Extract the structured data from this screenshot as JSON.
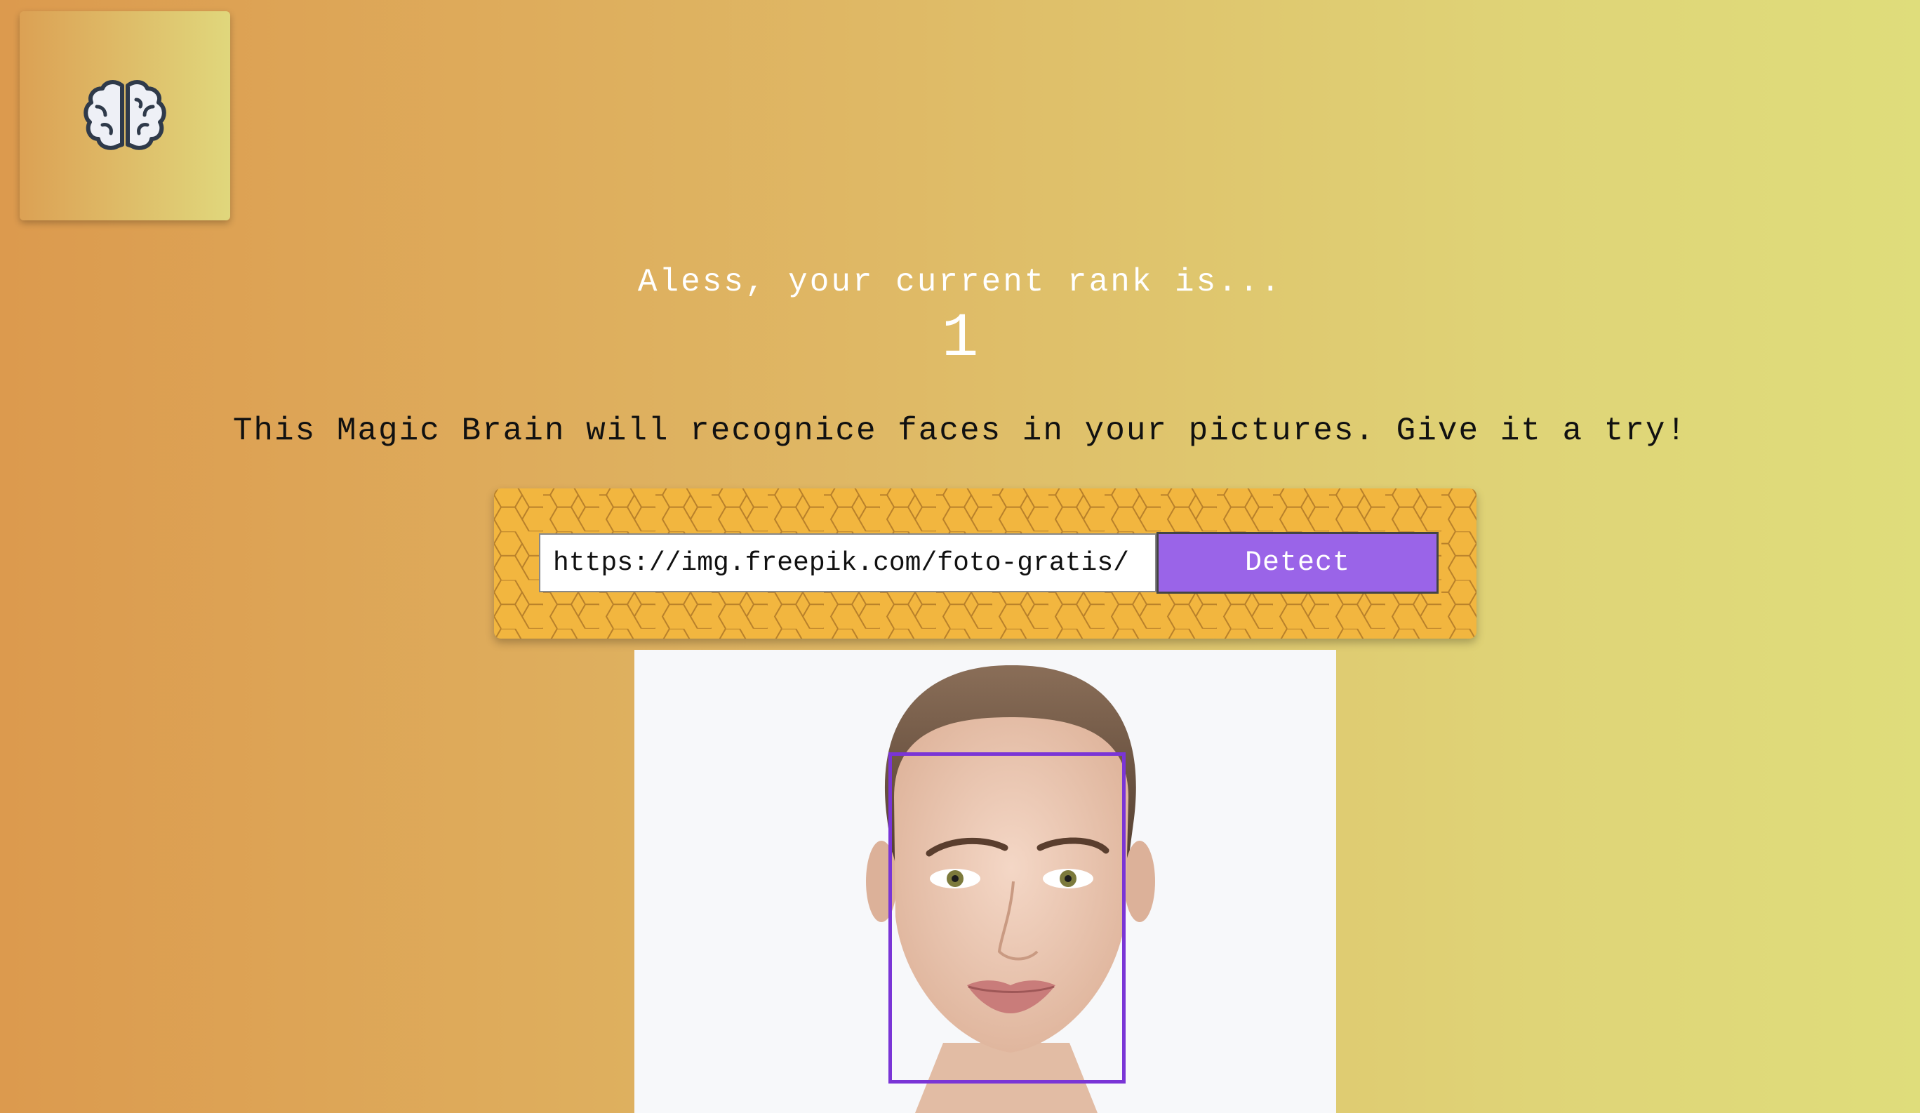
{
  "navigation": {
    "logo_icon": "brain-icon"
  },
  "rank": {
    "label": "Aless, your current rank is...",
    "value": "1"
  },
  "intro": {
    "text": "This Magic Brain will recognice faces in your pictures. Give it a try!"
  },
  "image_form": {
    "url_value": "https://img.freepik.com/foto-gratis/",
    "detect_label": "Detect"
  },
  "face_detection": {
    "image_icon": "portrait-photo",
    "box_color": "#7a35d6"
  },
  "colors": {
    "background_left": "#dc9a4e",
    "background_right": "#dfdd7b",
    "button": "#9a64e8",
    "panel": "#f2b63f"
  }
}
